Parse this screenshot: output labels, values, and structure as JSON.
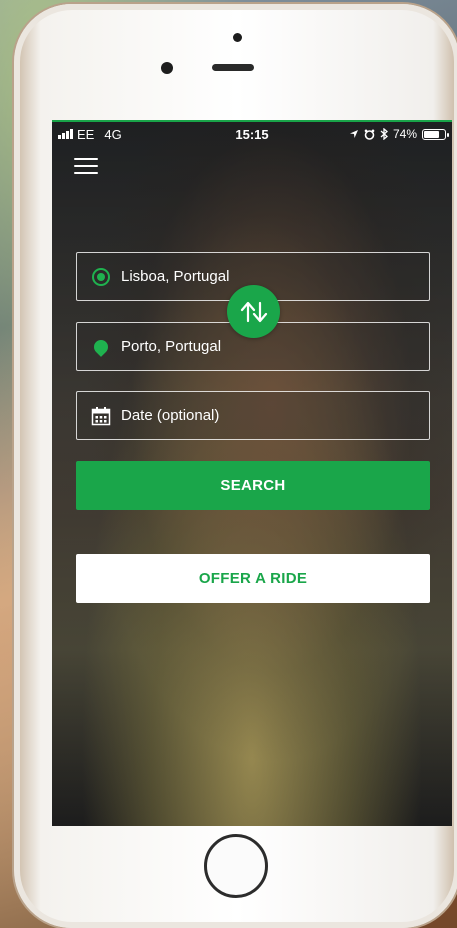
{
  "statusbar": {
    "carrier": "EE",
    "network": "4G",
    "time": "15:15",
    "battery": "74%",
    "battery_level": 0.74
  },
  "search_form": {
    "origin_value": "Lisboa, Portugal",
    "destination_value": "Porto, Portugal",
    "date_placeholder": "Date (optional)"
  },
  "buttons": {
    "search_label": "SEARCH",
    "offer_label": "OFFER A RIDE"
  },
  "colors": {
    "accent": "#1aa64a",
    "button_text_light": "#ffffff"
  },
  "icons": {
    "menu": "hamburger-menu-icon",
    "origin": "origin-dot-icon",
    "destination": "location-pin-icon",
    "date": "calendar-icon",
    "swap": "swap-arrows-icon"
  }
}
